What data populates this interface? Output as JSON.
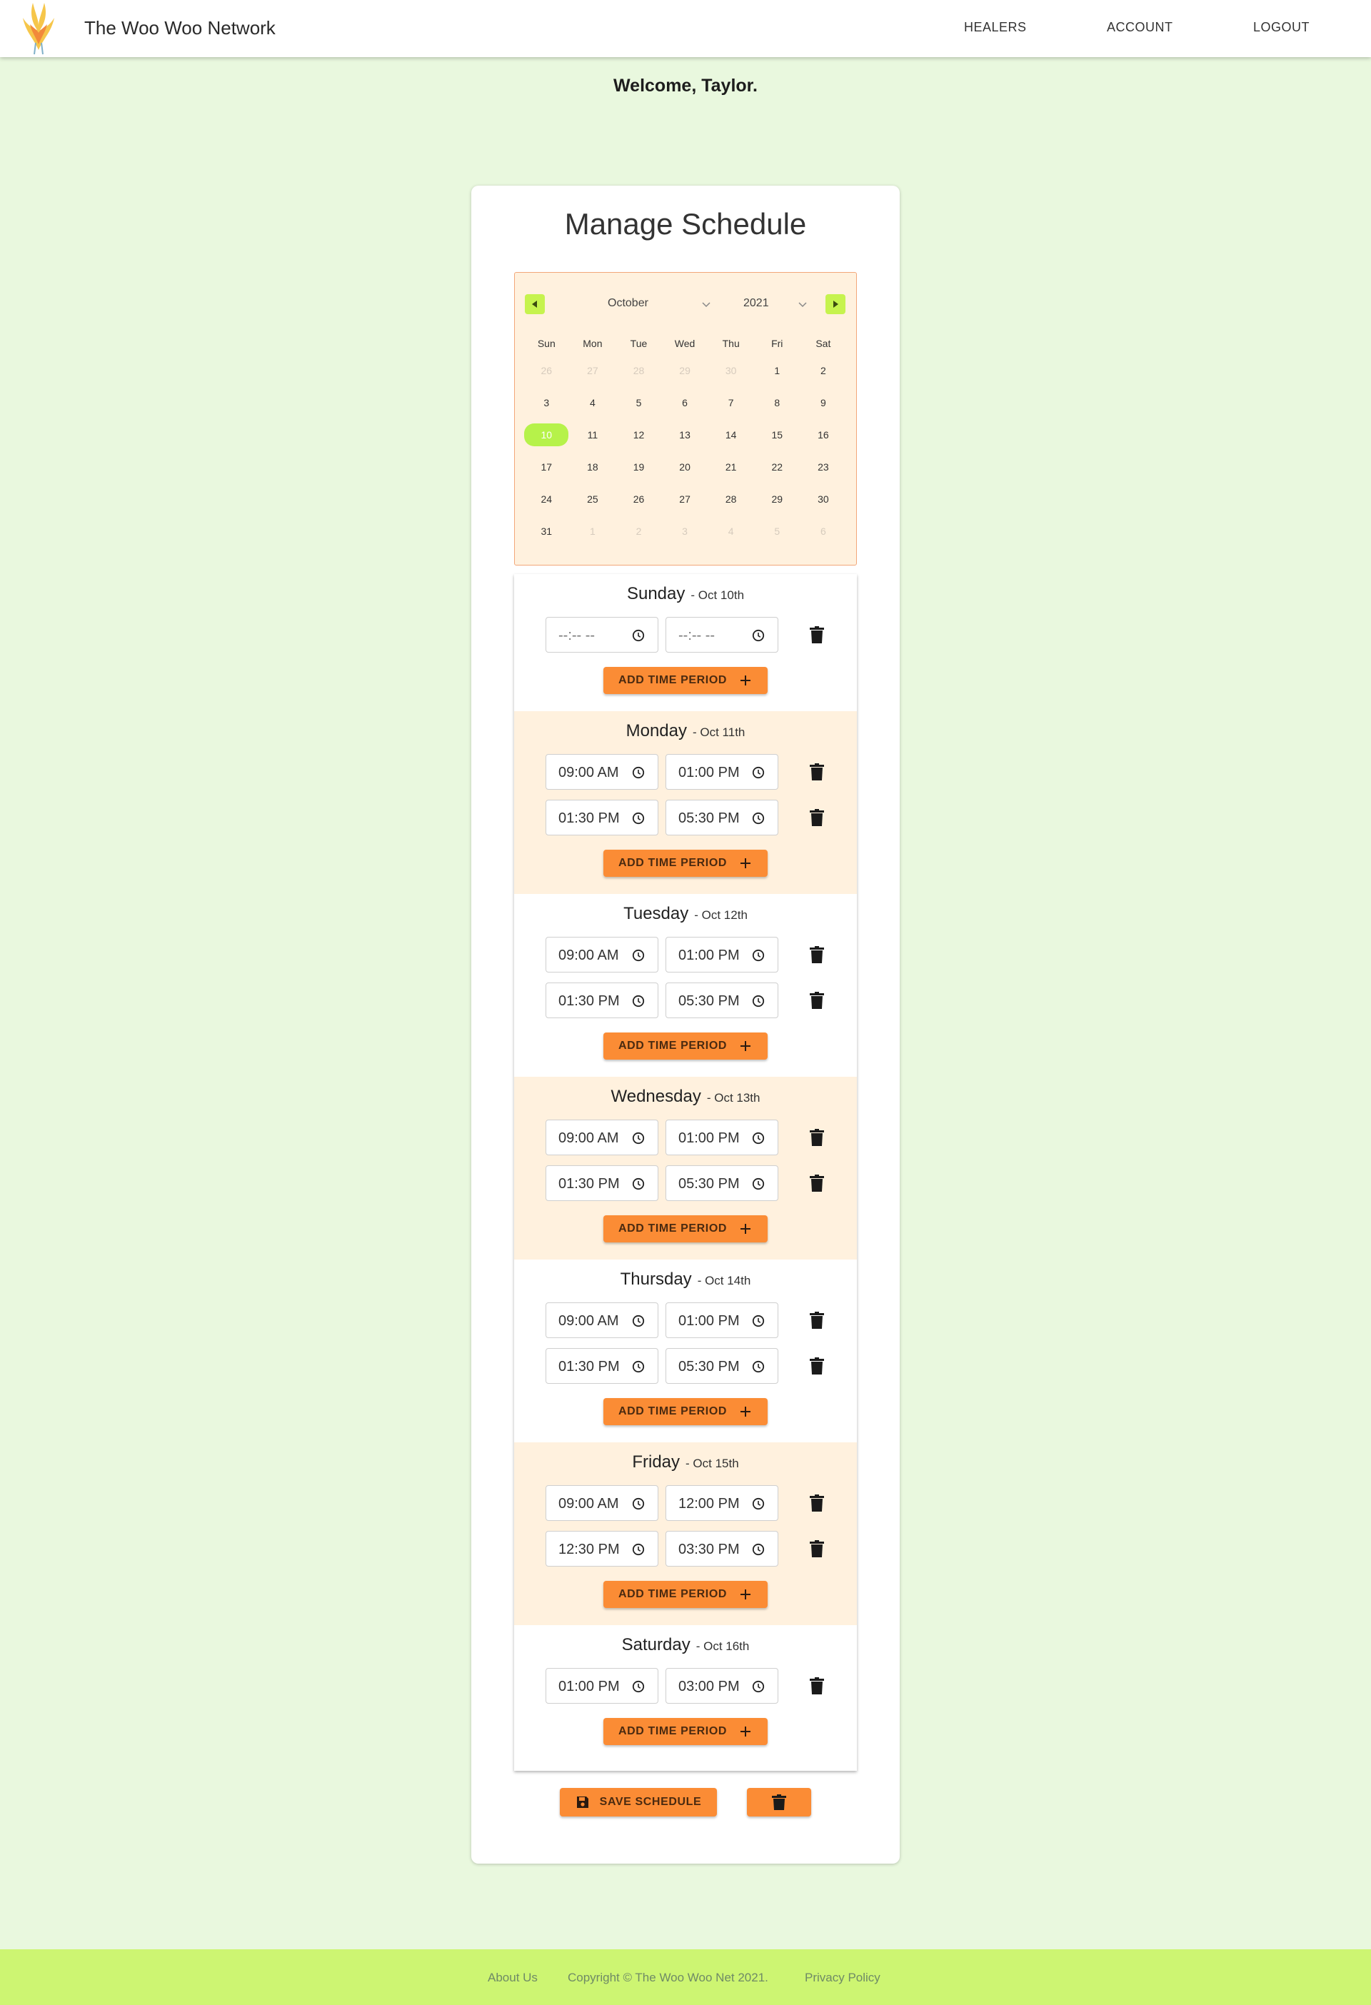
{
  "header": {
    "brand": "The Woo Woo Network",
    "nav": [
      "HEALERS",
      "ACCOUNT",
      "LOGOUT"
    ]
  },
  "welcome": "Welcome, Taylor.",
  "card": {
    "title": "Manage Schedule"
  },
  "calendar": {
    "month": "October",
    "year": "2021",
    "weekdays": [
      "Sun",
      "Mon",
      "Tue",
      "Wed",
      "Thu",
      "Fri",
      "Sat"
    ],
    "selected_day": "10",
    "days": [
      {
        "d": "26",
        "other": true
      },
      {
        "d": "27",
        "other": true
      },
      {
        "d": "28",
        "other": true
      },
      {
        "d": "29",
        "other": true
      },
      {
        "d": "30",
        "other": true
      },
      {
        "d": "1"
      },
      {
        "d": "2"
      },
      {
        "d": "3"
      },
      {
        "d": "4"
      },
      {
        "d": "5"
      },
      {
        "d": "6"
      },
      {
        "d": "7"
      },
      {
        "d": "8"
      },
      {
        "d": "9"
      },
      {
        "d": "10"
      },
      {
        "d": "11"
      },
      {
        "d": "12"
      },
      {
        "d": "13"
      },
      {
        "d": "14"
      },
      {
        "d": "15"
      },
      {
        "d": "16"
      },
      {
        "d": "17"
      },
      {
        "d": "18"
      },
      {
        "d": "19"
      },
      {
        "d": "20"
      },
      {
        "d": "21"
      },
      {
        "d": "22"
      },
      {
        "d": "23"
      },
      {
        "d": "24"
      },
      {
        "d": "25"
      },
      {
        "d": "26"
      },
      {
        "d": "27"
      },
      {
        "d": "28"
      },
      {
        "d": "29"
      },
      {
        "d": "30"
      },
      {
        "d": "31"
      },
      {
        "d": "1",
        "other": true
      },
      {
        "d": "2",
        "other": true
      },
      {
        "d": "3",
        "other": true
      },
      {
        "d": "4",
        "other": true
      },
      {
        "d": "5",
        "other": true
      },
      {
        "d": "6",
        "other": true
      }
    ]
  },
  "schedule": {
    "add_label": "ADD TIME PERIOD",
    "days": [
      {
        "name": "Sunday",
        "date": "Oct 10th",
        "periods": [
          [
            "--:-- --",
            "--:-- --"
          ]
        ]
      },
      {
        "name": "Monday",
        "date": "Oct 11th",
        "periods": [
          [
            "09:00 AM",
            "01:00 PM"
          ],
          [
            "01:30 PM",
            "05:30 PM"
          ]
        ]
      },
      {
        "name": "Tuesday",
        "date": "Oct 12th",
        "periods": [
          [
            "09:00 AM",
            "01:00 PM"
          ],
          [
            "01:30 PM",
            "05:30 PM"
          ]
        ]
      },
      {
        "name": "Wednesday",
        "date": "Oct 13th",
        "periods": [
          [
            "09:00 AM",
            "01:00 PM"
          ],
          [
            "01:30 PM",
            "05:30 PM"
          ]
        ]
      },
      {
        "name": "Thursday",
        "date": "Oct 14th",
        "periods": [
          [
            "09:00 AM",
            "01:00 PM"
          ],
          [
            "01:30 PM",
            "05:30 PM"
          ]
        ]
      },
      {
        "name": "Friday",
        "date": "Oct 15th",
        "periods": [
          [
            "09:00 AM",
            "12:00 PM"
          ],
          [
            "12:30 PM",
            "03:30 PM"
          ]
        ]
      },
      {
        "name": "Saturday",
        "date": "Oct 16th",
        "periods": [
          [
            "01:00 PM",
            "03:00 PM"
          ]
        ]
      }
    ]
  },
  "actions": {
    "save_label": "SAVE SCHEDULE"
  },
  "footer": {
    "about": "About Us",
    "copyright": "Copyright © The Woo Woo Net 2021.",
    "privacy": "Privacy Policy"
  },
  "colors": {
    "accent": "#fb8c35",
    "lime": "#c6f34e",
    "background": "#e9f8de",
    "tint": "#fff1de",
    "footer": "#cdf572"
  }
}
